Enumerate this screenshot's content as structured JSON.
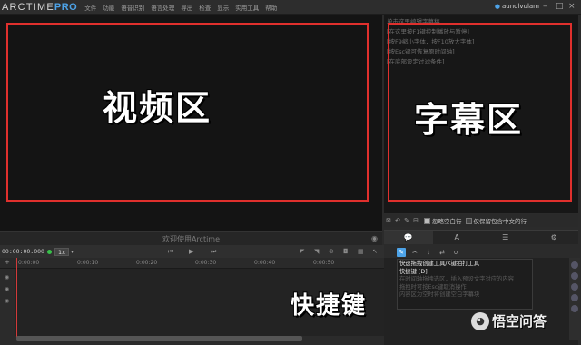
{
  "app": {
    "logo_main": "ARCTIME",
    "logo_suffix": "PRO",
    "menu": [
      "文件",
      "功能",
      "语音识别",
      "语言处理",
      "导出",
      "检查",
      "显示",
      "实用工具",
      "帮助"
    ],
    "user": "aunolvulam"
  },
  "video": {
    "welcome": "欢迎使用Arctime",
    "overlay_label": "视频区"
  },
  "subtitle_panel": {
    "lines": [
      "单击这里编辑字幕稿",
      "[在这里按F1键控制播放与暂停]",
      "[按F9缩小字体，按F10放大字体]",
      "[按Esc键可恢复原时间轴]",
      "[在底部设定过滤条件]"
    ],
    "overlay_label": "字幕区",
    "checkbox_ignore_empty": "忽略空白行",
    "checkbox_only_chinese": "仅保留包含中文的行"
  },
  "tabs": [
    "💬",
    "A",
    "☰",
    "⚙"
  ],
  "timeline": {
    "timecode": "00:00:00.000",
    "speed": "1x",
    "ticks": [
      "0:00:00",
      "0:00:10",
      "0:00:20",
      "0:00:30",
      "0:00:40",
      "0:00:50"
    ]
  },
  "tooltip": {
    "lines": [
      "快速拖拽创建工具/K键拍打工具",
      "快捷键 [D]",
      "在时间轴拖拽选区，插入预设文字对应的内容",
      "拖拽时可按Esc键取消操作",
      "内容区为空时将创建空白字幕块"
    ]
  },
  "overlays": {
    "shortcut_label": "快捷键"
  },
  "watermark": {
    "text": "悟空问答"
  },
  "colors": {
    "accent": "#4da3e8",
    "annotation_red": "#e0302d",
    "status_green": "#38c04a"
  }
}
